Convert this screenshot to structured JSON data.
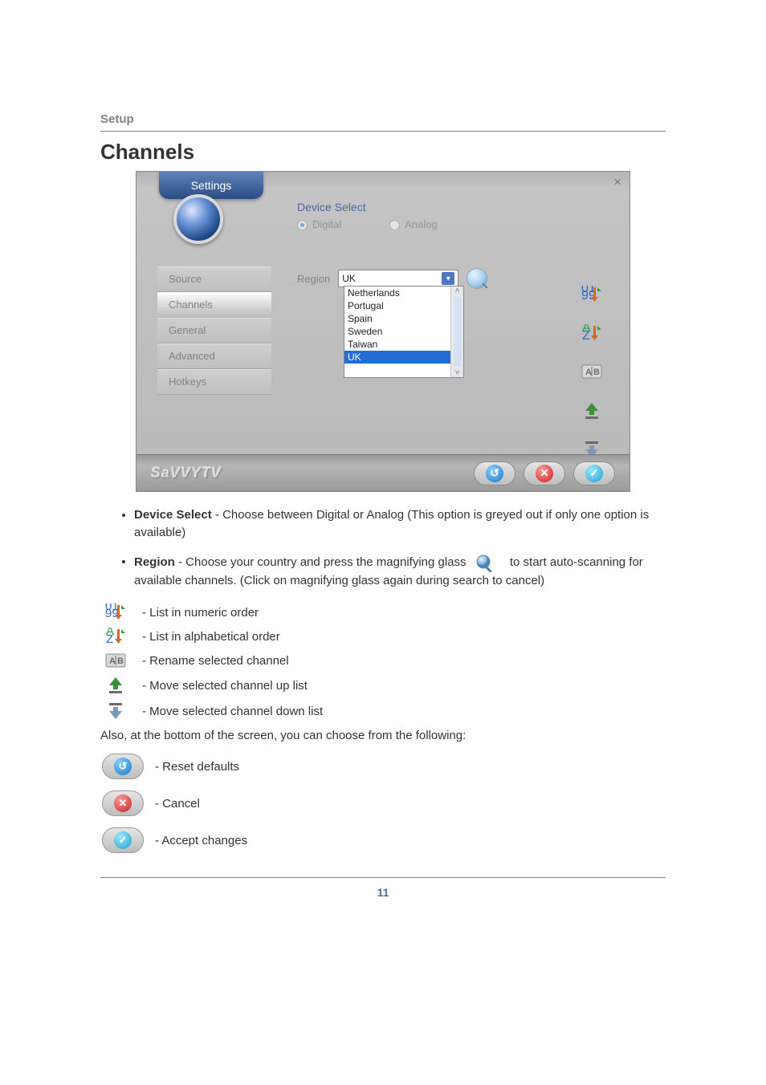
{
  "header": {
    "setup": "Setup",
    "title": "Channels"
  },
  "shot": {
    "tab": "Settings",
    "device_select_label": "Device Select",
    "radio_digital": "Digital",
    "radio_analog": "Analog",
    "region_label": "Region",
    "region_value": "UK",
    "region_options": [
      "Netherlands",
      "Portugal",
      "Spain",
      "Sweden",
      "Taiwan",
      "UK"
    ],
    "sidebar": [
      "Source",
      "Channels",
      "General",
      "Advanced",
      "Hotkeys"
    ],
    "logo": "SaVVYTV"
  },
  "bullets": {
    "device_select_bold": "Device Select",
    "device_select_rest": " - Choose between Digital or Analog (This option is greyed out if only one option is available)",
    "region_bold": "Region",
    "region_part1": " - Choose your country and press the magnifying glass ",
    "region_part2": " to start auto-scanning for available channels. (Click on magnifying glass again during search to cancel)"
  },
  "iconlegend": {
    "numeric": "- List in numeric order",
    "alpha": "- List in alphabetical order",
    "rename": "- Rename selected channel",
    "moveup": "- Move selected channel up list",
    "movedown": "- Move selected channel down list"
  },
  "below": "Also, at the bottom of the screen, you can choose from the following:",
  "pilllegend": {
    "reset": "- Reset defaults",
    "cancel": "- Cancel",
    "accept": "- Accept changes"
  },
  "page_number": "11"
}
